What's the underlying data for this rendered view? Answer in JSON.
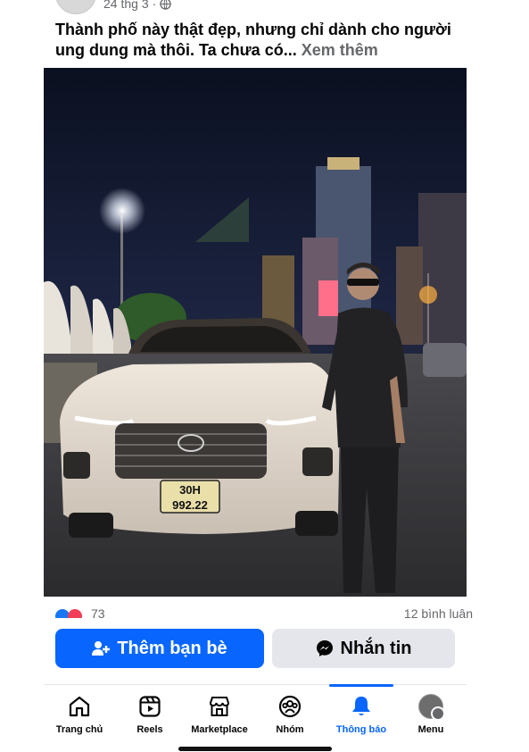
{
  "post": {
    "date": "24 thg 3",
    "caption": "Thành phố này thật đẹp, nhưng chỉ dành cho người ung dung mà thôi. Ta chưa có...",
    "see_more": "Xem thêm",
    "plate_line1": "30H",
    "plate_line2": "992.22"
  },
  "reactions": {
    "count": "73",
    "right_text": "12 bình luận"
  },
  "actions": {
    "add_friend": "Thêm bạn bè",
    "message": "Nhắn tin"
  },
  "tabs": [
    {
      "label": "Trang chủ",
      "icon": "home-icon"
    },
    {
      "label": "Reels",
      "icon": "reels-icon"
    },
    {
      "label": "Marketplace",
      "icon": "marketplace-icon"
    },
    {
      "label": "Nhóm",
      "icon": "groups-icon"
    },
    {
      "label": "Thông báo",
      "icon": "bell-icon",
      "active": true
    },
    {
      "label": "Menu",
      "icon": "profile-avatar"
    }
  ],
  "colors": {
    "accent": "#0866ff",
    "secondary_button": "#e4e6eb",
    "muted_text": "#65676b"
  }
}
